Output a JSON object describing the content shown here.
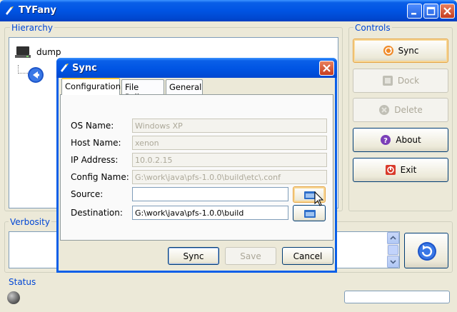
{
  "window": {
    "title": "TYFany"
  },
  "hierarchy": {
    "title": "Hierarchy",
    "root_label": "dump"
  },
  "controls": {
    "title": "Controls",
    "sync_label": "Sync",
    "dock_label": "Dock",
    "delete_label": "Delete",
    "about_label": "About",
    "exit_label": "Exit"
  },
  "verbosity": {
    "title": "Verbosity"
  },
  "status": {
    "title": "Status"
  },
  "dialog": {
    "title": "Sync",
    "tabs": [
      "Configuration",
      "File Policy",
      "General"
    ],
    "fields": {
      "os_name": {
        "label": "OS Name:",
        "value": "Windows XP"
      },
      "host_name": {
        "label": "Host Name:",
        "value": "xenon"
      },
      "ip_address": {
        "label": "IP Address:",
        "value": "10.0.2.15"
      },
      "config_name": {
        "label": "Config Name:",
        "value": "G:\\work\\java\\pfs-1.0.0\\build\\etc\\.conf"
      },
      "source": {
        "label": "Source:",
        "value": ""
      },
      "destination": {
        "label": "Destination:",
        "value": "G:\\work\\java\\pfs-1.0.0\\build"
      }
    },
    "buttons": {
      "sync": "Sync",
      "save": "Save",
      "cancel": "Cancel"
    }
  },
  "colors": {
    "titlebar": "#0054e3",
    "group_title": "#0046d5",
    "face": "#ece9d8"
  }
}
